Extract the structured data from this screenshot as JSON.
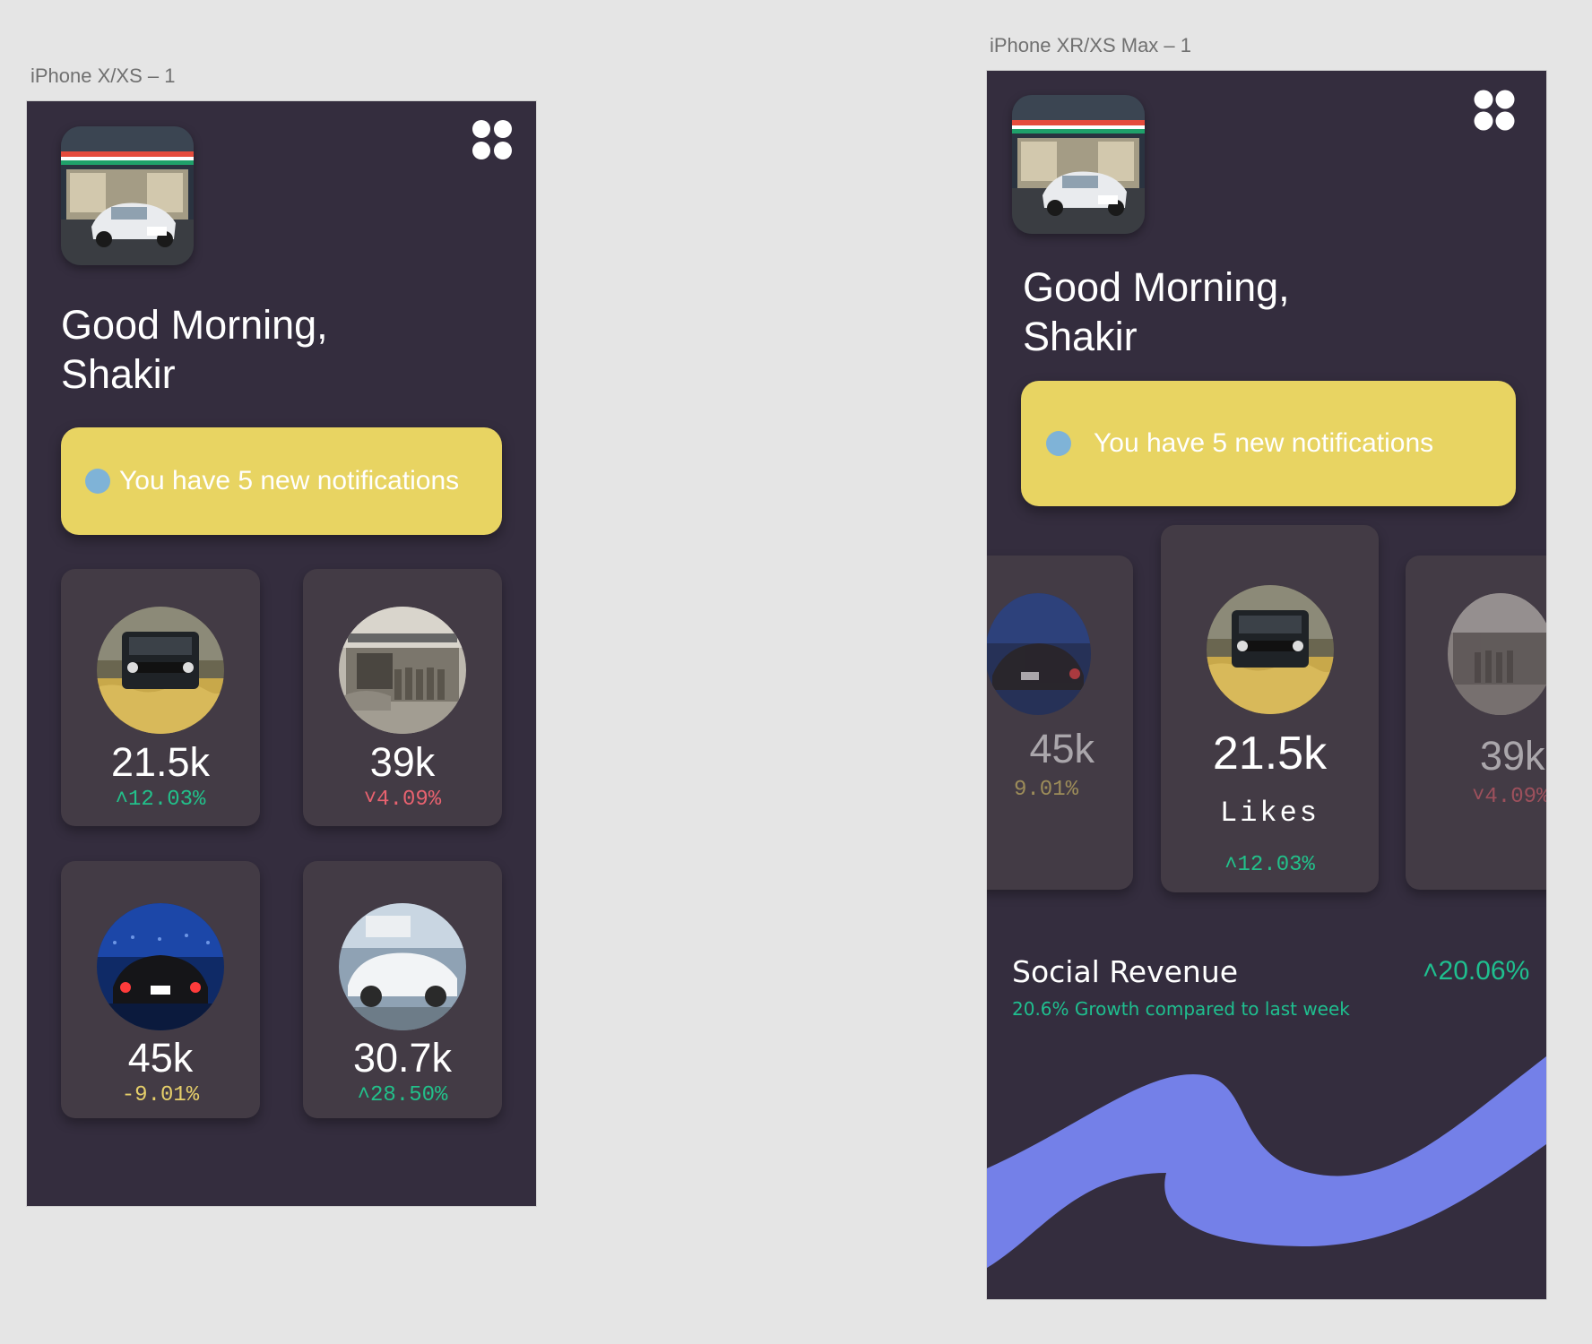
{
  "canvas": {
    "background": "#e5e5e5"
  },
  "colors": {
    "app_background": "#342d3e",
    "card_background": "#433b45",
    "notification_background": "#e8d462",
    "notification_dot": "#7fb3d7",
    "positive": "#22c08a",
    "negative": "#e8626f",
    "neutral_change": "#e6cf6a",
    "wave": "#7480e8"
  },
  "artboards": [
    {
      "label": "iPhone X/XS – 1",
      "greeting_line1": "Good Morning,",
      "greeting_line2": "Shakir",
      "notification": "You have 5 new notifications",
      "menu_icon": "four-dots-grid-icon",
      "cards": [
        {
          "value": "21.5k",
          "change": "˄12.03%",
          "trend": "up",
          "photo": "black-suv-in-wheat-field"
        },
        {
          "value": "39k",
          "change": "˅4.09%",
          "trend": "down",
          "photo": "vintage-workshop-group-photo"
        },
        {
          "value": "45k",
          "change": "-9.01%",
          "trend": "neutral",
          "photo": "sports-car-at-night"
        },
        {
          "value": "30.7k",
          "change": "˄28.50%",
          "trend": "up",
          "photo": "white-race-car"
        }
      ]
    },
    {
      "label": "iPhone XR/XS Max – 1",
      "greeting_line1": "Good Morning,",
      "greeting_line2": "Shakir",
      "notification": "You have 5 new notifications",
      "menu_icon": "four-dots-grid-icon",
      "carousel": {
        "left": {
          "value": "45k",
          "change": "9.01%"
        },
        "center": {
          "value": "21.5k",
          "label": "Likes",
          "change": "˄12.03%"
        },
        "right": {
          "value": "39k",
          "change": "˅4.09%"
        }
      },
      "revenue": {
        "title": "Social Revenue",
        "subtitle": "20.6% Growth compared to last week",
        "change": "˄20.06%"
      }
    }
  ]
}
